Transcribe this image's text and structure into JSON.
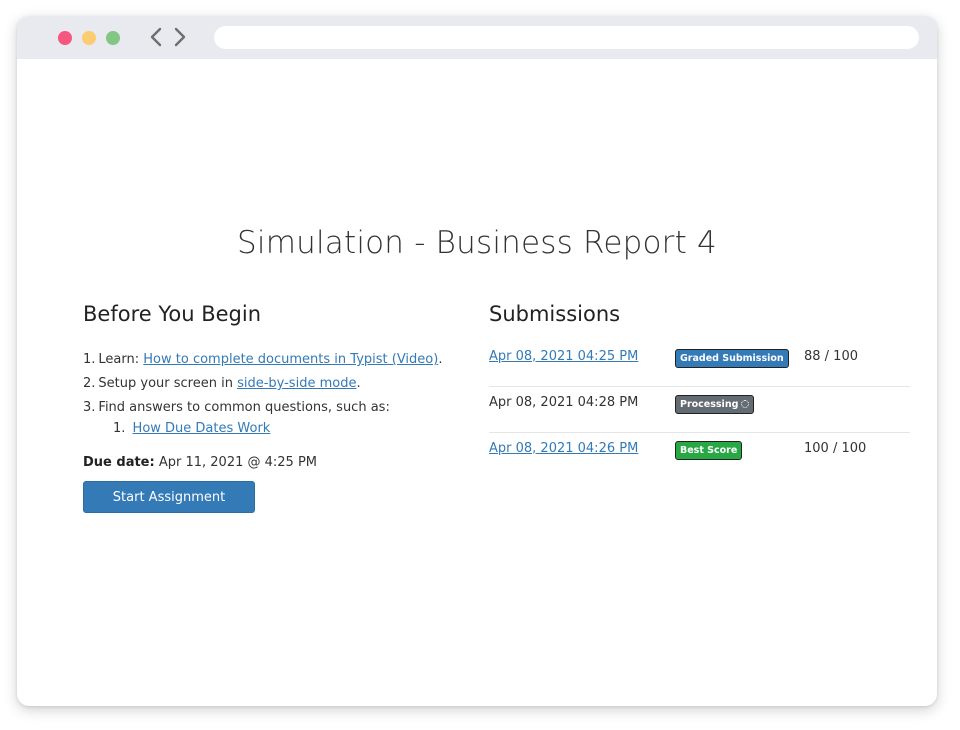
{
  "browser": {
    "address_value": "",
    "traffic_lights": [
      "close",
      "minimize",
      "maximize"
    ],
    "colors": {
      "close": "#f6577f",
      "minimize": "#fccc73",
      "maximize": "#84c684"
    }
  },
  "page": {
    "title": "Simulation - Business Report 4"
  },
  "before": {
    "heading": "Before You Begin",
    "steps": [
      {
        "num": "1.",
        "prefix": "Learn: ",
        "link": "How to complete documents in Typist (Video)",
        "suffix": "."
      },
      {
        "num": "2.",
        "prefix": "Setup your screen in ",
        "link": "side-by-side mode",
        "suffix": "."
      },
      {
        "num": "3.",
        "prefix": "Find answers to common questions, such as:",
        "link": "",
        "suffix": ""
      }
    ],
    "substeps": [
      {
        "num": "1.",
        "link": "How Due Dates Work"
      }
    ],
    "due_label": "Due date:",
    "due_value": "Apr 11, 2021 @ 4:25 PM",
    "start_button": "Start Assignment",
    "accent": "#337ab7"
  },
  "submissions": {
    "heading": "Submissions",
    "rows": [
      {
        "date": "Apr 08, 2021 04:25 PM",
        "is_link": true,
        "badge": "Graded Submission",
        "badge_color": "#337ab7",
        "score": "88 / 100"
      },
      {
        "date": "Apr 08, 2021 04:28 PM",
        "is_link": false,
        "badge": "Processing",
        "badge_color": "#636c72",
        "score": ""
      },
      {
        "date": "Apr 08, 2021 04:26 PM",
        "is_link": true,
        "badge": "Best Score",
        "badge_color": "#28a745",
        "score": "100 / 100"
      }
    ]
  }
}
